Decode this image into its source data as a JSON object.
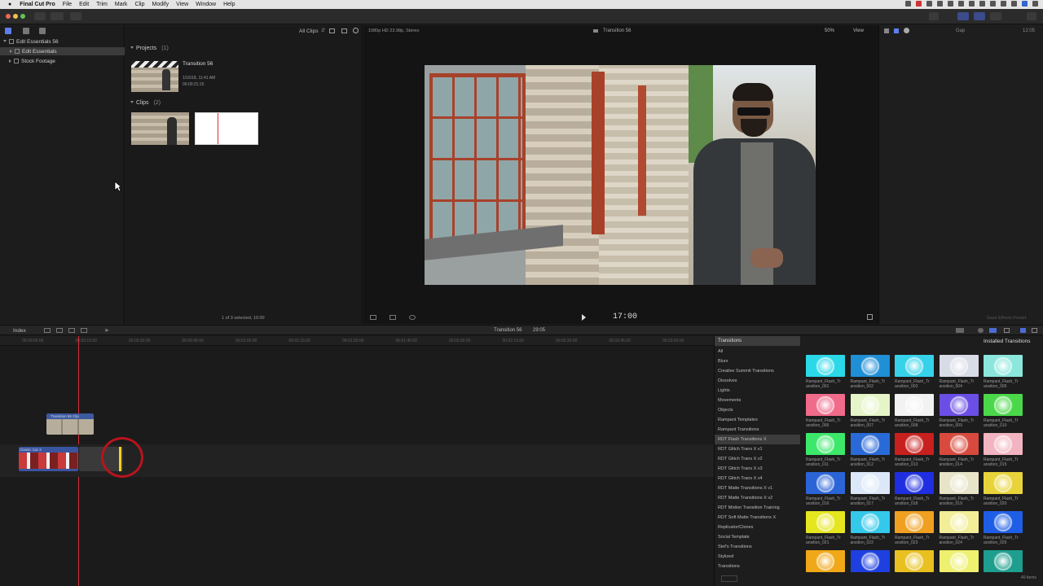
{
  "menubar": {
    "app": "Final Cut Pro",
    "items": [
      "File",
      "Edit",
      "Trim",
      "Mark",
      "Clip",
      "Modify",
      "View",
      "Window",
      "Help"
    ]
  },
  "libraries": {
    "items": [
      {
        "label": "Edit Essentials 56",
        "selected": false,
        "level": 0,
        "open": true
      },
      {
        "label": "Edit Essentials",
        "selected": true,
        "level": 1,
        "open": false
      },
      {
        "label": "Stock Footage",
        "selected": false,
        "level": 1,
        "open": false
      }
    ]
  },
  "browser": {
    "filter": "All Clips",
    "projects_header": "Projects",
    "projects_count": "(1)",
    "project_name": "Transition 56",
    "project_date": "1/16/18, 11:41 AM",
    "project_duration": "00:00:21:15",
    "clips_header": "Clips",
    "clips_count": "(2)",
    "selection_status": "1 of 3 selected, 10:00"
  },
  "viewer": {
    "format": "1080p HD 23.98p, Stereo",
    "title": "Transition 56",
    "zoom": "50%",
    "view_label": "View",
    "timecode": "17:00"
  },
  "inspector": {
    "gap_label": "Gap",
    "duration": "12:05",
    "save_button": "Save Effects Preset"
  },
  "timeline": {
    "index_label": "Index",
    "project_label": "Transition 56",
    "duration_label": "29:05",
    "ruler_ticks": [
      "00:00:00:00",
      "00:00:15:00",
      "00:00:30:00",
      "00:00:45:00",
      "00:01:00:00",
      "00:01:15:00",
      "00:01:30:00",
      "00:01:45:00",
      "00:02:00:00",
      "00:02:15:00",
      "00:02:30:00",
      "00:02:45:00",
      "00:03:00:00"
    ],
    "connected_clip_label": "Transition 56 Clip",
    "primary_clip_label": "Classic Car 2"
  },
  "transitions": {
    "header": "Transitions",
    "installed_label": "Installed Transitions",
    "categories": [
      "All",
      "Blurs",
      "Creative Summit Transitions",
      "Dissolves",
      "Lights",
      "Movements",
      "Objects",
      "Rampant Templates",
      "Rampant Transitions",
      "RDT Flash Transitions X",
      "RDT Glitch Trans X v1",
      "RDT Glitch Trans X v2",
      "RDT Glitch Trans X v3",
      "RDT Glitch Trans X v4",
      "RDT Matte Transitions X v1",
      "RDT Matte Transitions X v2",
      "RDT Motion Transition Training",
      "RDT Soft Matte Transitions X",
      "Replicator/Clones",
      "Social Template",
      "Stef's Transitions",
      "Stylized",
      "Transitions"
    ],
    "selected_category": "RDT Flash Transitions X",
    "items": [
      {
        "label": "Rampant_Flash_Tr ansition_001",
        "color": "#2ad8e8"
      },
      {
        "label": "Rampant_Flash_Tr ansition_002",
        "color": "#1f8fd6"
      },
      {
        "label": "Rampant_Flash_Tr ansition_003",
        "color": "#36d2ea"
      },
      {
        "label": "Rampant_Flash_Tr ansition_004",
        "color": "#d8dce6"
      },
      {
        "label": "Rampant_Flash_Tr ansition_005",
        "color": "#8be6dc"
      },
      {
        "label": "Rampant_Flash_Tr ansition_006",
        "color": "#f06a8a"
      },
      {
        "label": "Rampant_Flash_Tr ansition_007",
        "color": "#e6f5c8"
      },
      {
        "label": "Rampant_Flash_Tr ansition_008",
        "color": "#f2f2f2"
      },
      {
        "label": "Rampant_Flash_Tr ansition_009",
        "color": "#6a4ee6"
      },
      {
        "label": "Rampant_Flash_Tr ansition_010",
        "color": "#4ad84a"
      },
      {
        "label": "Rampant_Flash_Tr ansition_011",
        "color": "#3ce86a"
      },
      {
        "label": "Rampant_Flash_Tr ansition_012",
        "color": "#2a6ad8"
      },
      {
        "label": "Rampant_Flash_Tr ansition_013",
        "color": "#c8201e"
      },
      {
        "label": "Rampant_Flash_Tr ansition_014",
        "color": "#d84a3e"
      },
      {
        "label": "Rampant_Flash_Tr ansition_015",
        "color": "#f2b4c0"
      },
      {
        "label": "Rampant_Flash_Tr ansition_016",
        "color": "#2a64d6"
      },
      {
        "label": "Rampant_Flash_Tr ansition_017",
        "color": "#dce8f8"
      },
      {
        "label": "Rampant_Flash_Tr ansition_018",
        "color": "#1e2ee0"
      },
      {
        "label": "Rampant_Flash_Tr ansition_019",
        "color": "#e8e4c8"
      },
      {
        "label": "Rampant_Flash_Tr ansition_020",
        "color": "#e8d43a"
      },
      {
        "label": "Rampant_Flash_Tr ansition_021",
        "color": "#e6e620"
      },
      {
        "label": "Rampant_Flash_Tr ansition_022",
        "color": "#34c8ea"
      },
      {
        "label": "Rampant_Flash_Tr ansition_023",
        "color": "#f0a020"
      },
      {
        "label": "Rampant_Flash_Tr ansition_024",
        "color": "#f2ee98"
      },
      {
        "label": "Rampant_Flash_Tr ansition_025",
        "color": "#1e5ee6"
      },
      {
        "label": "",
        "color": "#f0a818"
      },
      {
        "label": "",
        "color": "#1e40e0"
      },
      {
        "label": "",
        "color": "#e8c020"
      },
      {
        "label": "",
        "color": "#eef070"
      },
      {
        "label": "",
        "color": "#1e9e8e"
      }
    ],
    "count_label": "40 items"
  }
}
